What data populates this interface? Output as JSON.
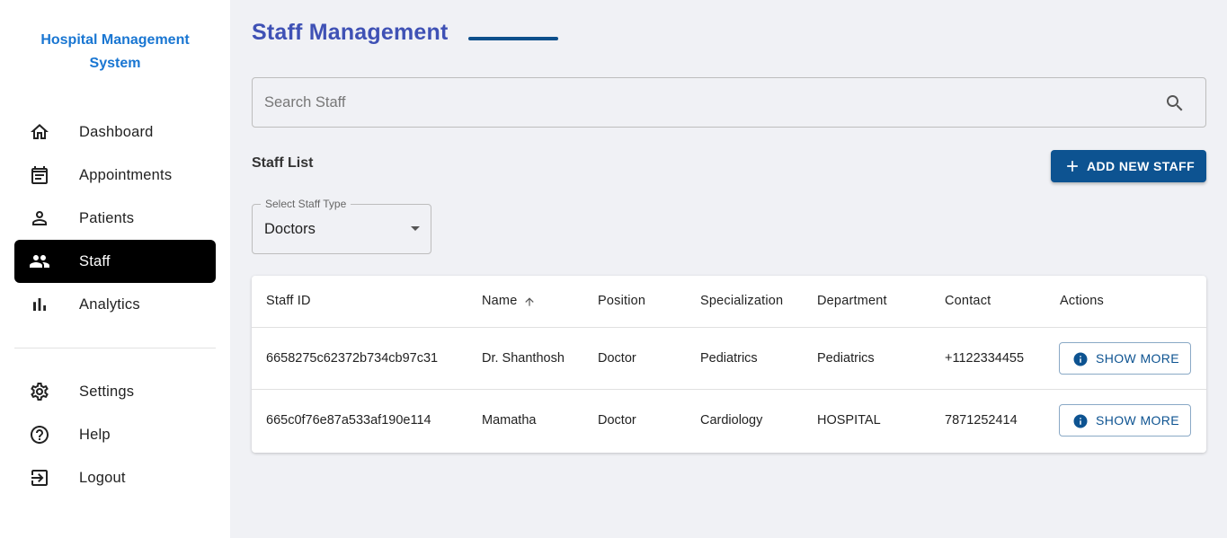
{
  "sidebar": {
    "brand": "Hospital Management System",
    "items": [
      {
        "label": "Dashboard",
        "icon": "home-icon"
      },
      {
        "label": "Appointments",
        "icon": "calendar-icon"
      },
      {
        "label": "Patients",
        "icon": "person-icon"
      },
      {
        "label": "Staff",
        "icon": "people-icon",
        "active": true
      },
      {
        "label": "Analytics",
        "icon": "bar-chart-icon"
      }
    ],
    "bottom_items": [
      {
        "label": "Settings",
        "icon": "gear-icon"
      },
      {
        "label": "Help",
        "icon": "help-circle-icon"
      },
      {
        "label": "Logout",
        "icon": "logout-icon"
      }
    ]
  },
  "main": {
    "title": "Staff Management",
    "search": {
      "placeholder": "Search Staff",
      "value": ""
    },
    "section_title": "Staff List",
    "add_button_label": "ADD NEW STAFF",
    "staff_type": {
      "legend": "Select Staff Type",
      "selected": "Doctors"
    },
    "table": {
      "columns": [
        "Staff ID",
        "Name",
        "Position",
        "Specialization",
        "Department",
        "Contact",
        "Actions"
      ],
      "sorted_column": "Name",
      "rows": [
        {
          "id": "6658275c62372b734cb97c31",
          "name": "Dr. Shanthosh",
          "position": "Doctor",
          "specialization": "Pediatrics",
          "department": "Pediatrics",
          "contact": "+1122334455",
          "action": "SHOW MORE"
        },
        {
          "id": "665c0f76e87a533af190e114",
          "name": "Mamatha",
          "position": "Doctor",
          "specialization": "Cardiology",
          "department": "HOSPITAL",
          "contact": "7871252414",
          "action": "SHOW MORE"
        }
      ]
    }
  },
  "colors": {
    "brand": "#1976d2",
    "title": "#3f51b5",
    "primary_button": "#0d5391",
    "active_nav": "#000000"
  }
}
